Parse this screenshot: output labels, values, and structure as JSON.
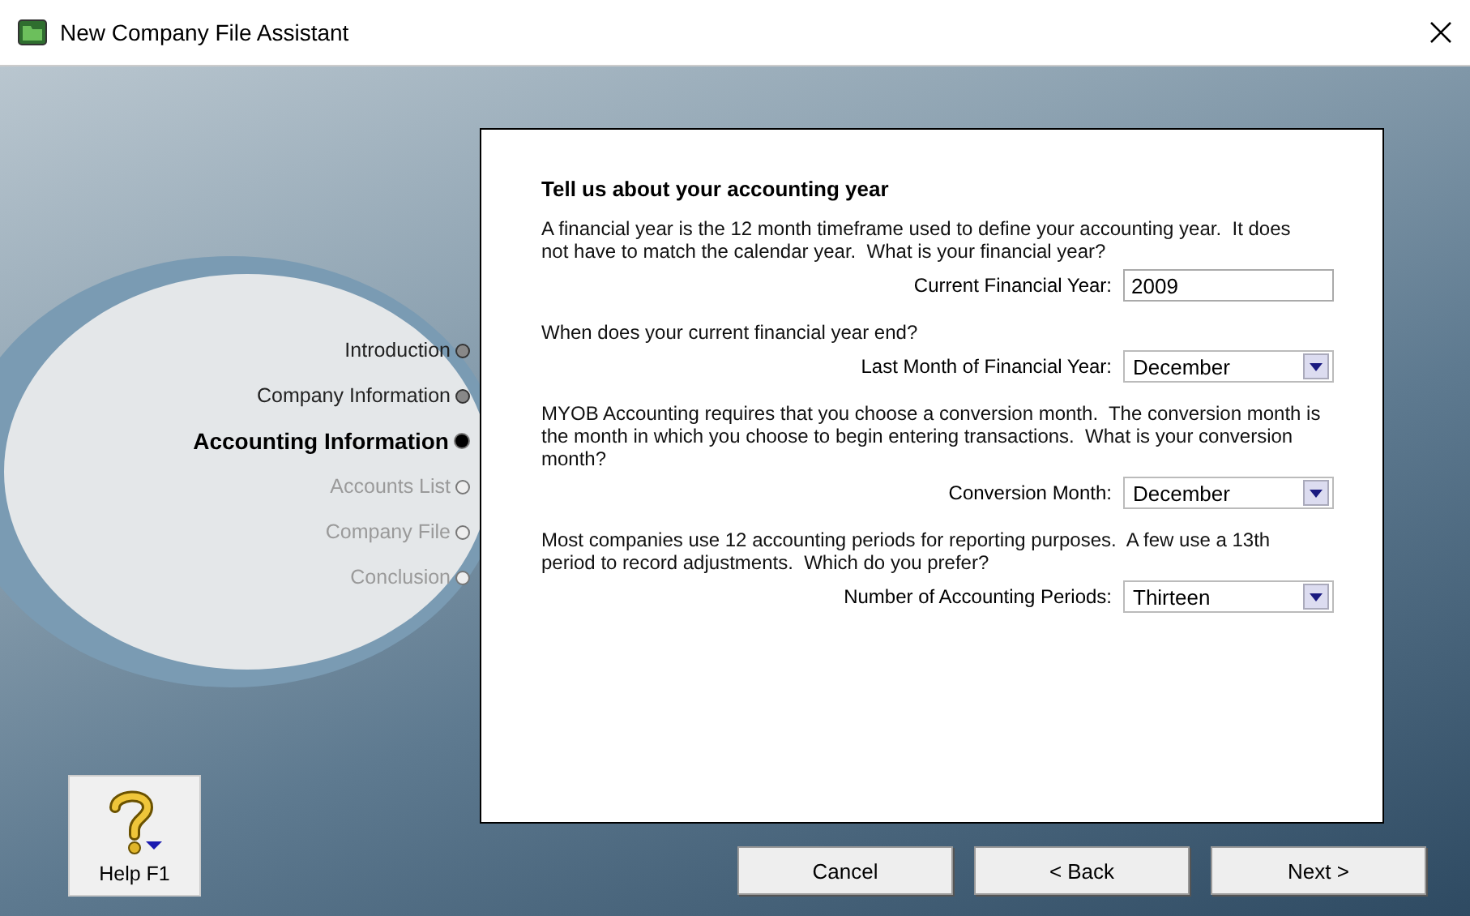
{
  "window": {
    "title": "New Company File Assistant"
  },
  "steps": [
    {
      "label": "Introduction",
      "completed": true,
      "current": false
    },
    {
      "label": "Company Information",
      "completed": true,
      "current": false
    },
    {
      "label": "Accounting Information",
      "completed": false,
      "current": true
    },
    {
      "label": "Accounts List",
      "completed": false,
      "current": false
    },
    {
      "label": "Company File",
      "completed": false,
      "current": false
    },
    {
      "label": "Conclusion",
      "completed": false,
      "current": false
    }
  ],
  "panel": {
    "heading": "Tell us about your accounting year",
    "sections": [
      {
        "question": "A financial year is the 12 month timeframe used to define your accounting year.  It does not have to match the calendar year.  What is your financial year?",
        "field": {
          "label": "Current Financial Year:",
          "kind": "text",
          "value": "2009"
        }
      },
      {
        "question": "When does your current financial year end?",
        "field": {
          "label": "Last Month of Financial Year:",
          "kind": "dropdown",
          "value": "December"
        }
      },
      {
        "question": "MYOB Accounting requires that you choose a conversion month.  The conversion month is the month in which you choose to begin entering transactions.  What is your conversion month?",
        "field": {
          "label": "Conversion Month:",
          "kind": "dropdown",
          "value": "December"
        }
      },
      {
        "question": "Most companies use 12 accounting periods for reporting purposes.  A few use a 13th period to record adjustments.  Which do you prefer?",
        "field": {
          "label": "Number of Accounting Periods:",
          "kind": "dropdown",
          "value": "Thirteen"
        }
      }
    ]
  },
  "help": {
    "label": "Help F1"
  },
  "buttons": [
    {
      "label": "Cancel"
    },
    {
      "label": "< Back"
    },
    {
      "label": "Next >"
    }
  ]
}
